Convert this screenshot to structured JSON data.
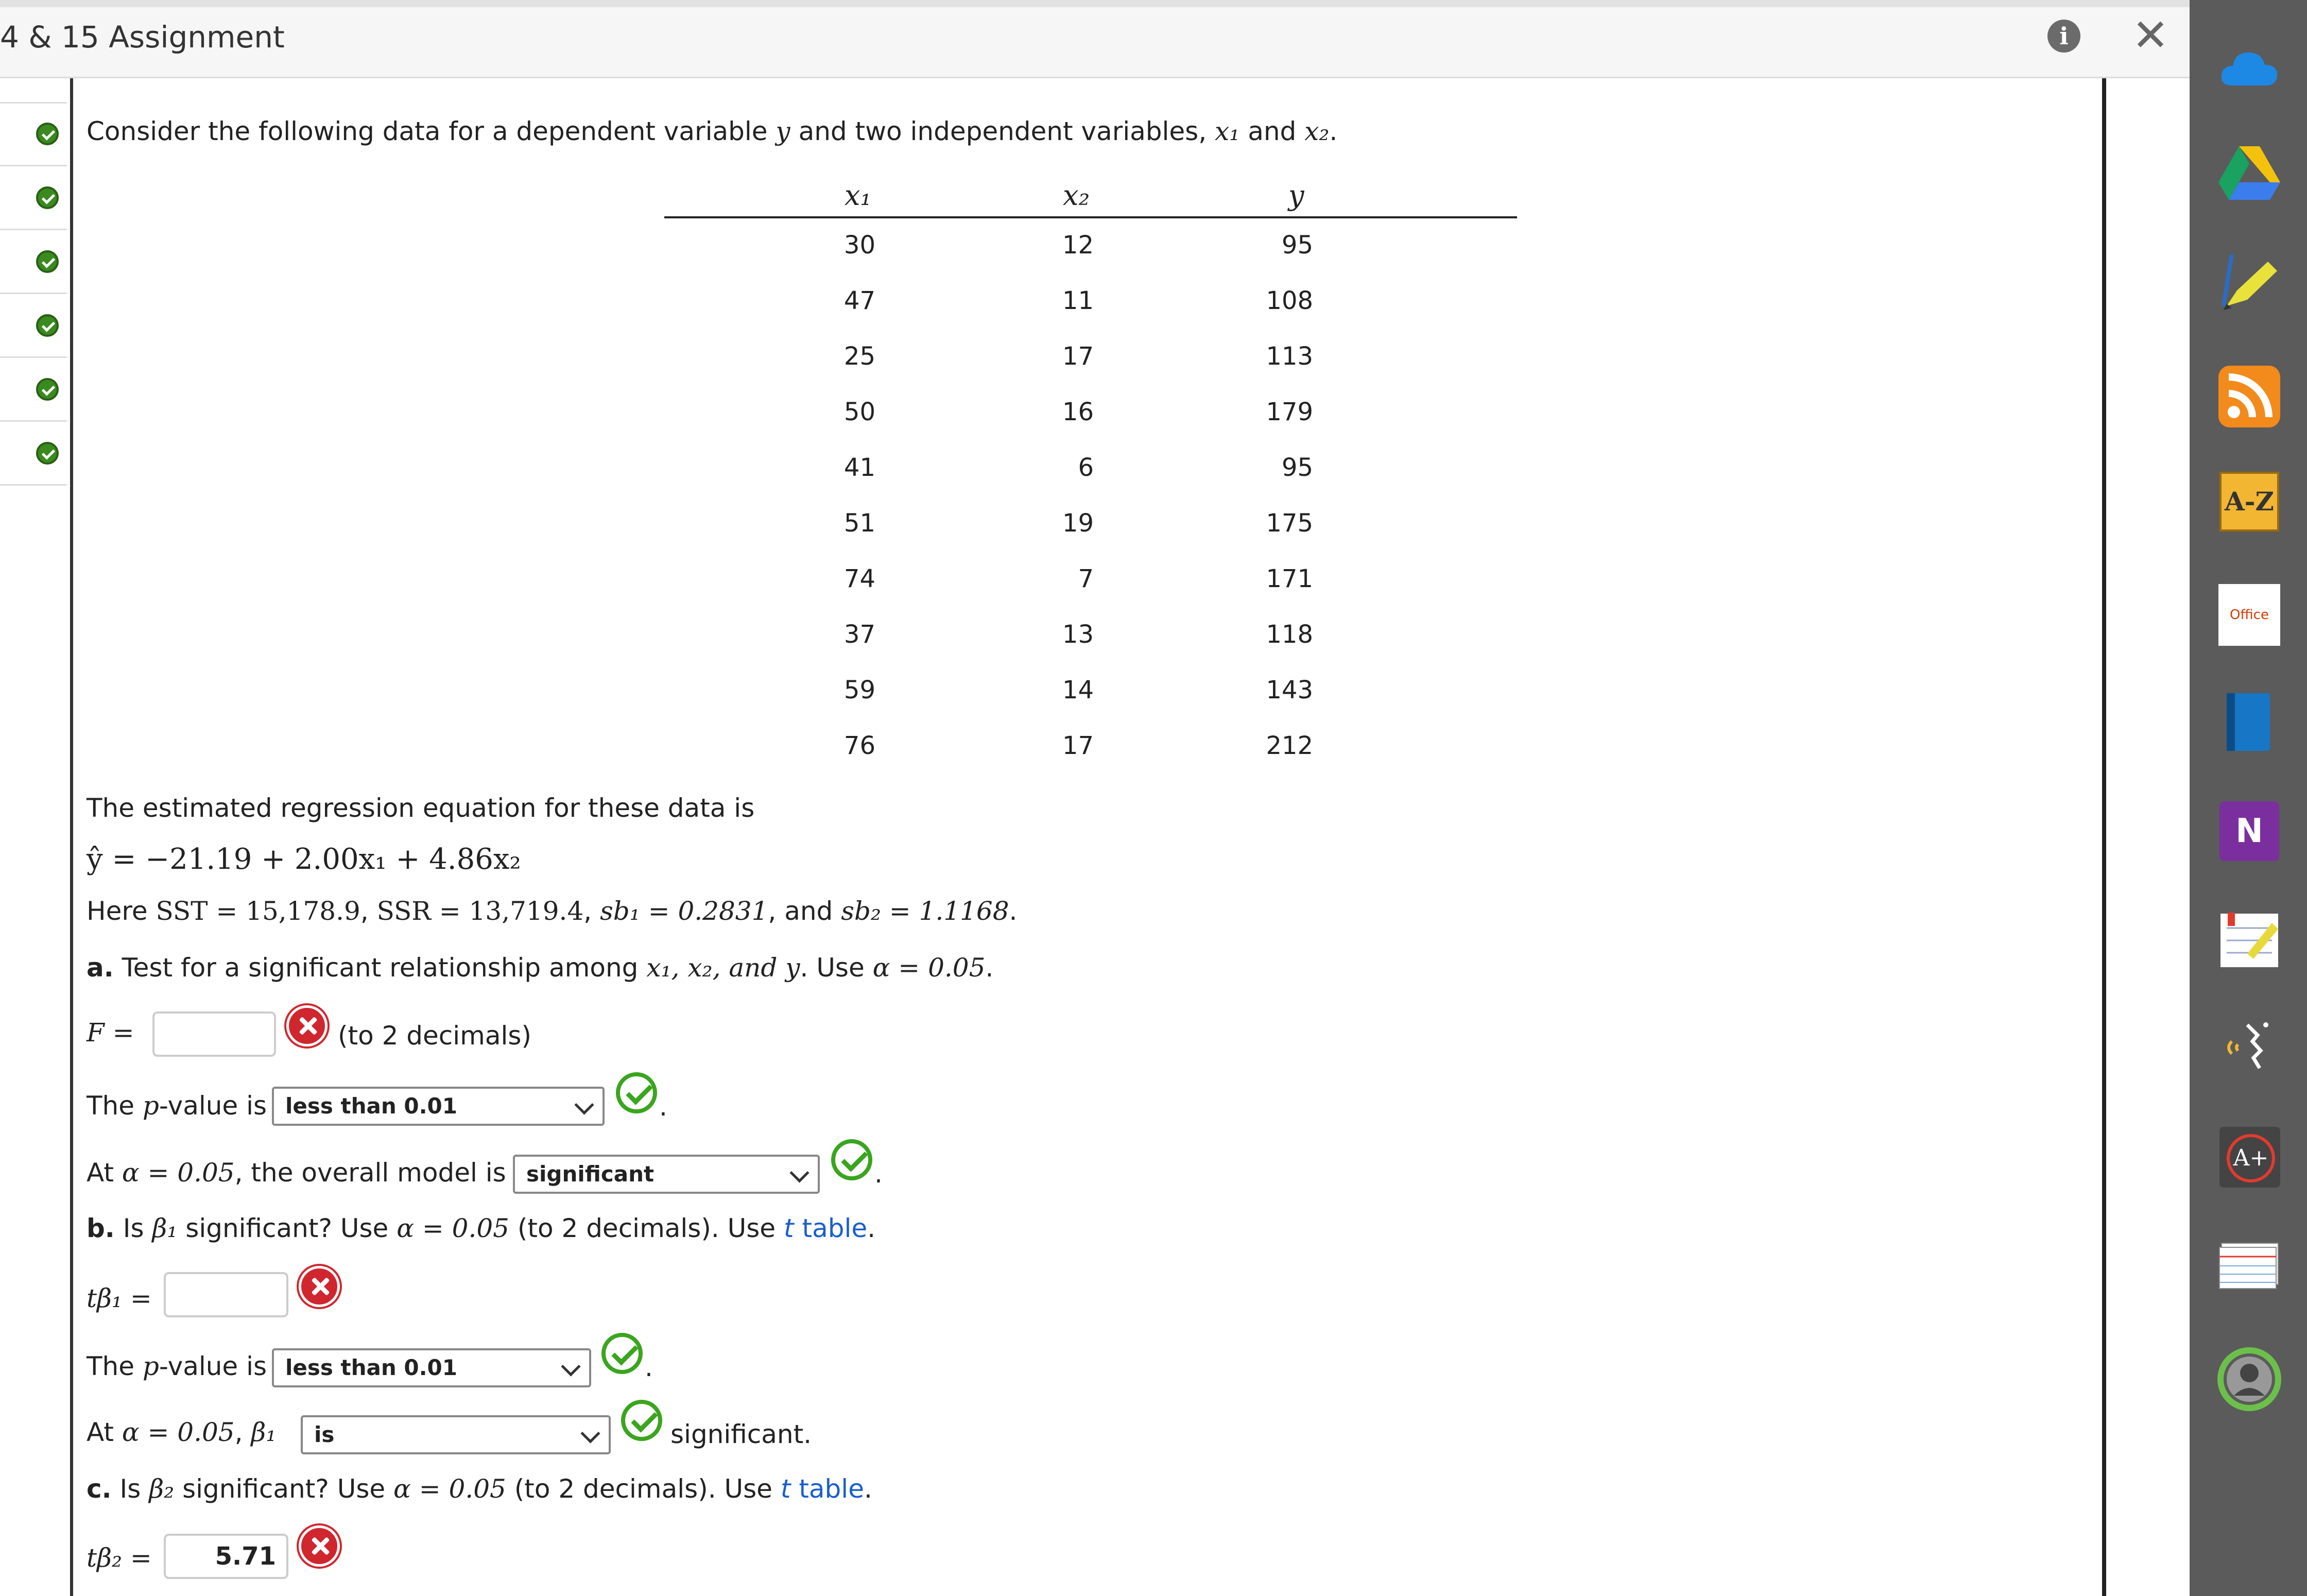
{
  "header": {
    "title": "4 & 15 Assignment"
  },
  "intro": {
    "text": "Consider the following data for a dependent variable",
    "y": "y",
    "mid": "and two independent variables,",
    "x1": "x₁",
    "and": "and",
    "x2": "x₂",
    "end": "."
  },
  "table": {
    "headers": [
      "x₁",
      "x₂",
      "y"
    ],
    "rows": [
      [
        "30",
        "12",
        "95"
      ],
      [
        "47",
        "11",
        "108"
      ],
      [
        "25",
        "17",
        "113"
      ],
      [
        "50",
        "16",
        "179"
      ],
      [
        "41",
        "6",
        "95"
      ],
      [
        "51",
        "19",
        "175"
      ],
      [
        "74",
        "7",
        "171"
      ],
      [
        "37",
        "13",
        "118"
      ],
      [
        "59",
        "14",
        "143"
      ],
      [
        "76",
        "17",
        "212"
      ]
    ]
  },
  "regression": {
    "lead": "The estimated regression equation for these data is",
    "equation": "ŷ = −21.19 + 2.00x₁ + 4.86x₂",
    "here": "Here",
    "sst": "SST = 15,178.9",
    "ssr": "SSR = 13,719.4",
    "sb1": "sb₁ = 0.2831",
    "and": ", and",
    "sb2": "sb₂ = 1.1168",
    "comma": ","
  },
  "part_a": {
    "label": "a.",
    "text": "Test for a significant relationship among",
    "vars": "x₁, x₂, and y",
    "use": ". Use",
    "alpha": "α = 0.05",
    "f_label": "F =",
    "f_value": "",
    "f_note": "(to 2 decimals)",
    "pvalue_lead": "The",
    "p": "p",
    "pvalue_tail": "-value is",
    "pvalue_select": "less than 0.01",
    "at": "At",
    "model_text": ", the overall model is",
    "model_select": "significant"
  },
  "part_b": {
    "label": "b.",
    "text": "Is",
    "beta": "β₁",
    "text2": "significant? Use",
    "alpha": "α = 0.05",
    "note": "(to 2 decimals). Use",
    "link": "t table",
    "t_label": "tβ₁ =",
    "t_value": "",
    "pvalue_select": "less than 0.01",
    "sig_select": "is",
    "sig_text": "significant."
  },
  "part_c": {
    "label": "c.",
    "text": "Is",
    "beta": "β₂",
    "text2": "significant? Use",
    "alpha": "α = 0.05",
    "note": "(to 2 decimals). Use",
    "link": "t table",
    "t_label": "tβ₂ =",
    "t_value": "5.71"
  },
  "toolbar": {
    "icons": [
      "cloud-icon",
      "google-drive-icon",
      "highlighter-icon",
      "rss-icon",
      "a-z-icon",
      "office-icon",
      "book-icon",
      "onenote-icon",
      "notes-icon",
      "read-aloud-icon",
      "grade-icon",
      "index-card-icon",
      "avatar-icon"
    ],
    "az_label": "A-Z",
    "office_label": "Office",
    "onenote_label": "N",
    "grade_label": "A+"
  },
  "colors": {
    "correct": "#3aa51e",
    "incorrect": "#d0262e",
    "link": "#1a5ecc",
    "toolbar": "#5b5b5b"
  }
}
